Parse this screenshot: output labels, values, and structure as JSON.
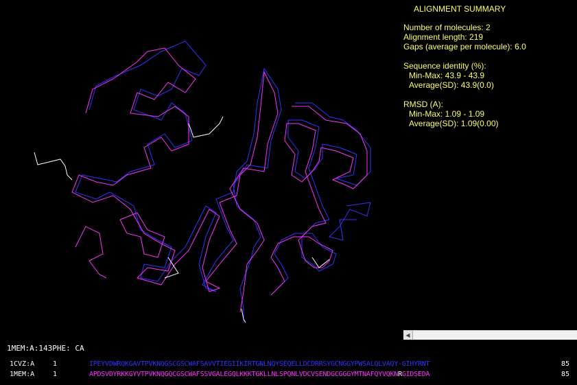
{
  "summary": {
    "title": "ALIGNMENT SUMMARY",
    "num_molecules": "Number of molecules: 2",
    "alignment_length": "Alignment length: 219",
    "gaps": "Gaps (average per molecule): 6.0",
    "seq_identity_header": "Sequence identity (%):",
    "seq_identity_minmax": "Min-Max: 43.9 - 43.9",
    "seq_identity_avg": "Average(SD): 43.9(0.0)",
    "rmsd_header": "RMSD (A):",
    "rmsd_minmax": "Min-Max: 1.09 - 1.09",
    "rmsd_avg": "Average(SD): 1.09(0.00)"
  },
  "status": {
    "picked_atom": "1MEM:A:143PHE: CA"
  },
  "scrollbar": {
    "left_arrow_icon": "arrow-left-icon"
  },
  "colors": {
    "chain1": "#3333ff",
    "chain2": "#ff33ff",
    "unaligned": "#ffffff",
    "summary_text": "#ffff66",
    "background": "#000000"
  },
  "alignment": [
    {
      "id": "1CVZ:A",
      "start": "1",
      "sequence": "IPEYVDWRQKGAVTPVKNQGSCGSCWAFSAVVTIEGIIKIRTGNLNQYSEQELLDCDRRSYGCNGGYPWSALQLVAQY-GIHYRNT",
      "end": "85",
      "color": "#3333ff"
    },
    {
      "id": "1MEM:A",
      "start": "1",
      "sequence": "APDSVDYRKKGYVTPVKNQGQCGSCWAFSSVGALEGQLKKKTGKLLNLSPQNLVDCVSENDGCGGGYMTNAFQYVQKNRGIDSEDA",
      "end": "85",
      "color": "#ff33ff",
      "white_positions": [
        78
      ]
    }
  ]
}
